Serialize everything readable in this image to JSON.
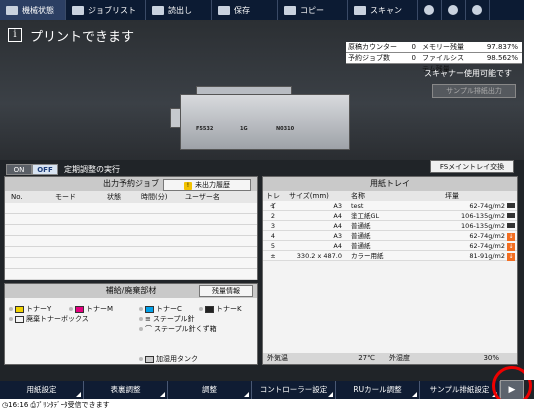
{
  "topbar": {
    "tabs": [
      {
        "label": "機械状態",
        "icon": "machine-status-icon"
      },
      {
        "label": "ジョブリスト",
        "icon": "job-list-icon"
      },
      {
        "label": "読出し",
        "icon": "recall-icon"
      },
      {
        "label": "保存",
        "icon": "save-icon"
      },
      {
        "label": "コピー",
        "icon": "copy-icon"
      },
      {
        "label": "スキャン",
        "icon": "scan-icon"
      }
    ]
  },
  "status": {
    "message": "プリントできます",
    "scanner_message": "スキャナー使用可能です",
    "sample_output_label": "サンプル排紙出力"
  },
  "counters": [
    {
      "k1": "原稿カウンター",
      "v1": "0",
      "k2": "メモリー残量",
      "v2": "97.837%"
    },
    {
      "k1": "予約ジョブ数",
      "v1": "0",
      "k2": "ファイルシステム残量",
      "v2": "98.562%"
    }
  ],
  "printer_labels": [
    "F5532",
    "1G",
    "N0310"
  ],
  "periodic": {
    "on": "ON",
    "off": "OFF",
    "label": "定期調整の実行"
  },
  "fs_tray_button": "FSメイントレイ交換",
  "jobs": {
    "title": "出力予約ジョブ",
    "unprinted_button": "未出力履歴",
    "columns": [
      "No.",
      "モード",
      "状態",
      "時間(分)",
      "ユーザー名"
    ]
  },
  "supplies": {
    "title": "補給/廃棄部材",
    "info_button": "残量情報",
    "items": {
      "toner_y": "トナーY",
      "toner_m": "トナーM",
      "toner_c": "トナーC",
      "toner_k": "トナーK",
      "waste_toner": "廃棄トナーボックス",
      "staples": "ステープル針",
      "staple_waste": "ステープル針くず箱",
      "humid_tank": "加湿用タンク"
    }
  },
  "trays": {
    "title": "用紙トレイ",
    "columns": [
      "トレイ",
      "サイズ(mm)",
      "名称",
      "坪量"
    ],
    "rows": [
      {
        "tray": "1",
        "size": "A3",
        "name": "test",
        "weight": "62-74g/m2",
        "state": "bar"
      },
      {
        "tray": "2",
        "size": "A4",
        "name": "塗工紙GL",
        "weight": "106-135g/m2",
        "state": "bar"
      },
      {
        "tray": "3",
        "size": "A4",
        "name": "普通紙",
        "weight": "106-135g/m2",
        "state": "bar"
      },
      {
        "tray": "4",
        "size": "A3",
        "name": "普通紙",
        "weight": "62-74g/m2",
        "state": "warn"
      },
      {
        "tray": "5",
        "size": "A4",
        "name": "普通紙",
        "weight": "62-74g/m2",
        "state": "warn"
      },
      {
        "tray": "±",
        "size": "330.2 x 487.0",
        "name": "カラー用紙",
        "weight": "81-91g/m2",
        "state": "warn"
      }
    ],
    "outside_temp_label": "外気温",
    "outside_temp": "27℃",
    "humidity_label": "外湿度",
    "humidity": "30%"
  },
  "bottombar": {
    "buttons": [
      "用紙設定",
      "表裏調整",
      "調整",
      "コントローラー設定",
      "RUカール調整",
      "サンプル排紙設定"
    ],
    "next_label": "▶"
  },
  "statusbar": {
    "time": "16:16",
    "message": "ﾌﾟﾘﾝﾀﾃﾞｰﾀ受信できます"
  }
}
